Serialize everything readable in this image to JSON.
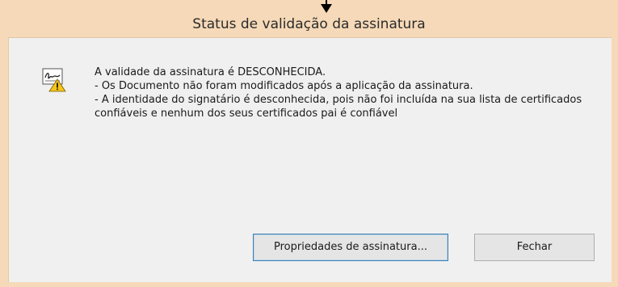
{
  "dialog": {
    "title": "Status de validação da assinatura",
    "icon": "signature-warning-icon",
    "message_lines": [
      "A validade da assinatura é DESCONHECIDA.",
      "- Os Documento não foram modificados após a aplicação da assinatura.",
      "- A identidade do signatário é desconhecida, pois não foi incluída na sua lista de certificados confiáveis e nenhum dos seus certificados pai é confiável"
    ],
    "buttons": {
      "properties_label": "Propriedades de assinatura...",
      "close_label": "Fechar"
    }
  },
  "annotation": {
    "arrow_icon": "down-arrow-icon"
  },
  "colors": {
    "frame": "#f6d9b8",
    "client": "#f0f0f0",
    "button": "#e5e5e5",
    "focus_border": "#3c7fb1"
  }
}
